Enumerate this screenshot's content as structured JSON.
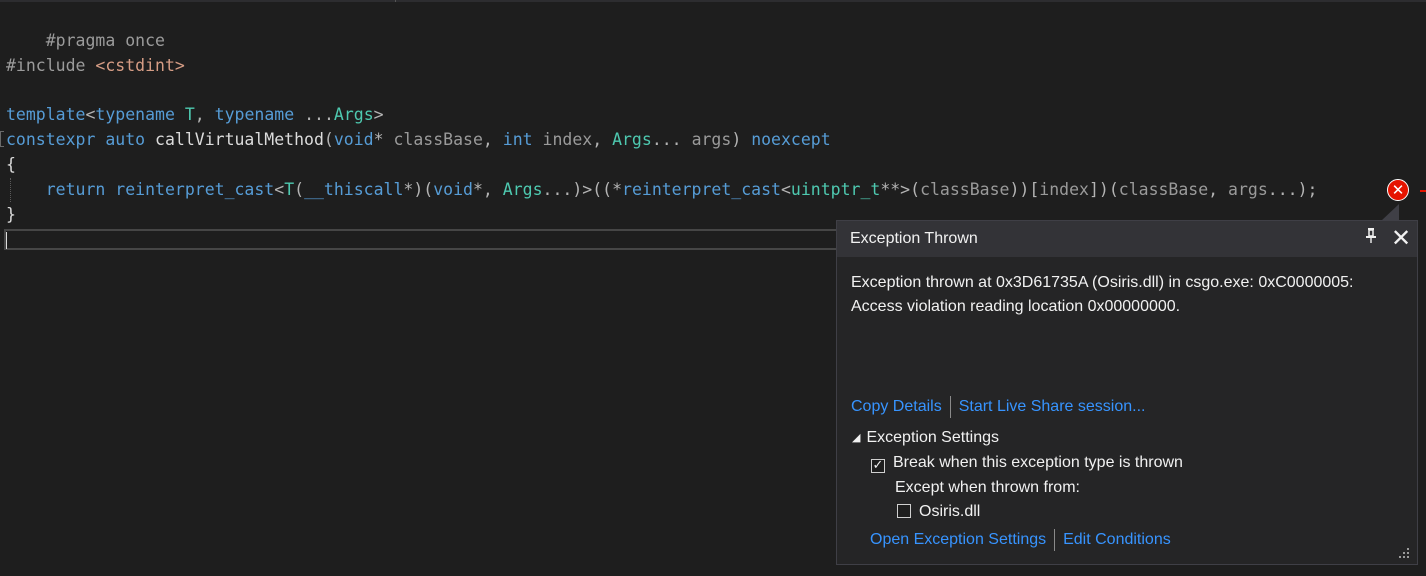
{
  "editor": {
    "lines": {
      "l1": {
        "directive": "#pragma once"
      },
      "l3": {
        "directive": "#include ",
        "header": "<cstdint>"
      },
      "l5": {
        "kw1": "template",
        "p1": "<",
        "kw2": "typename",
        "sp1": " ",
        "t": "T",
        "c1": ", ",
        "kw3": "typename",
        "sp2": " ...",
        "args": "Args",
        "p2": ">"
      },
      "l6": {
        "kw1": "constexpr",
        "sp1": " ",
        "kw2": "auto",
        "sp2": " ",
        "fn": "callVirtualMethod",
        "p1": "(",
        "kw3": "void",
        "p2": "* ",
        "pr1": "classBase",
        "c1": ", ",
        "kw4": "int",
        "sp3": " ",
        "pr2": "index",
        "c2": ", ",
        "args": "Args",
        "p3": "... ",
        "pr3": "args",
        "p4": ") ",
        "kw5": "noexcept"
      },
      "l7": {
        "brace": "{"
      },
      "l8": {
        "indent": "    ",
        "kw1": "return",
        "sp1": " ",
        "kw2": "reinterpret_cast",
        "p1": "<",
        "t": "T",
        "p2": "(",
        "kw3": "__thiscall",
        "p3": "*)(",
        "kw4": "void",
        "p4": "*, ",
        "args": "Args",
        "p5": "...)>((*",
        "kw5": "reinterpret_cast",
        "p6": "<",
        "ty": "uintptr_t",
        "p7": "**>(",
        "pr1": "classBase",
        "p8": "))[",
        "pr2": "index",
        "p9": "])(",
        "pr3": "classBase",
        "c1": ", ",
        "pr4": "args",
        "p10": "...);"
      },
      "l9": {
        "brace": "}"
      }
    },
    "error_glyph": "✕"
  },
  "popup": {
    "title": "Exception Thrown",
    "pin_glyph": "📌",
    "close_glyph": "✕",
    "message_line1": "Exception thrown at 0x3D61735A (Osiris.dll) in csgo.exe: 0xC0000005:",
    "message_line2": "Access violation reading location 0x00000000.",
    "copy_details": "Copy Details",
    "live_share": "Start Live Share session...",
    "settings_heading": "Exception Settings",
    "break_label": "Break when this exception type is thrown",
    "break_checked": "✓",
    "except_label": "Except when thrown from:",
    "osiris_label": "Osiris.dll",
    "open_settings": "Open Exception Settings",
    "edit_conditions": "Edit Conditions"
  },
  "icons": {
    "error": "error-circle-icon",
    "pin": "pin-icon",
    "close": "close-icon",
    "grip": "resize-grip-icon"
  },
  "colors": {
    "background": "#1e1e1e",
    "keyword": "#569cd6",
    "type": "#4ec9b0",
    "string": "#d69d85",
    "link": "#3794ff",
    "error": "#e51400"
  }
}
